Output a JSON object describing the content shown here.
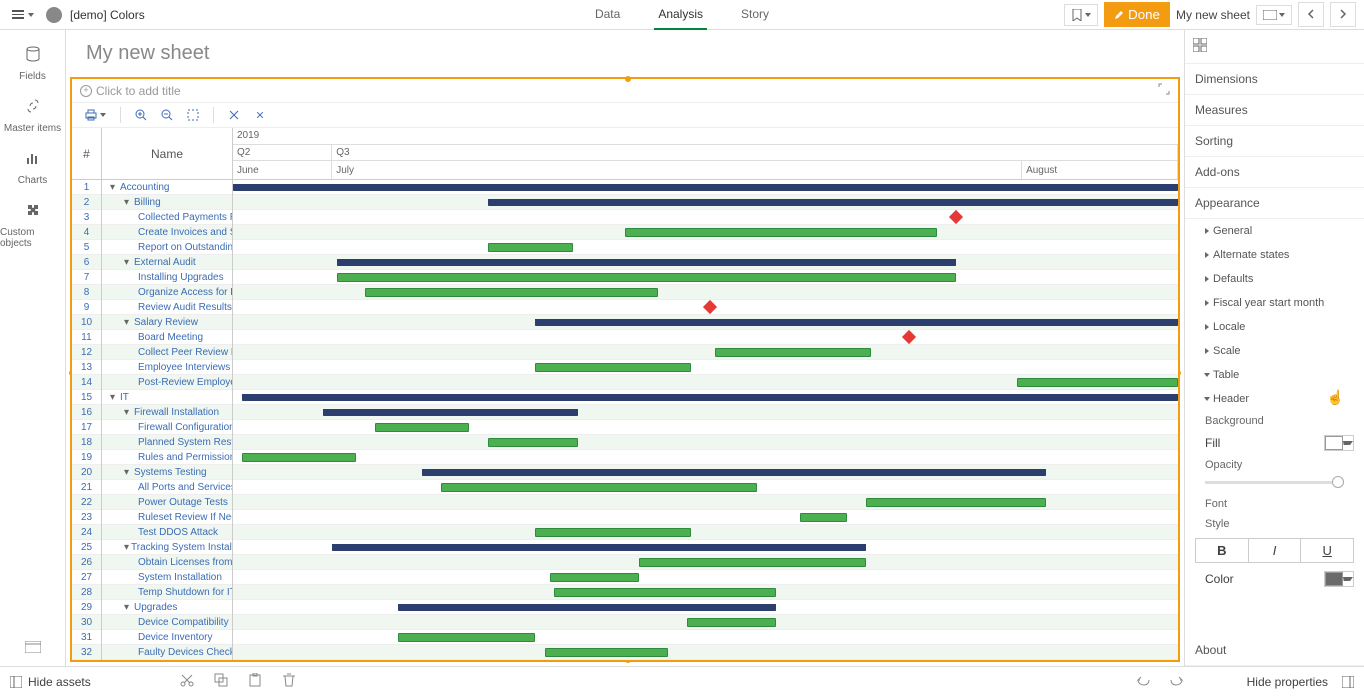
{
  "topbar": {
    "app_title": "[demo] Colors",
    "tabs": {
      "data": "Data",
      "analysis": "Analysis",
      "story": "Story"
    },
    "done": "Done",
    "sheet_name": "My new sheet"
  },
  "left_sidebar": {
    "fields": "Fields",
    "master": "Master items",
    "charts": "Charts",
    "custom": "Custom objects"
  },
  "sheet": {
    "title": "My new sheet",
    "add_title": "Click to add title"
  },
  "gantt_header": {
    "num": "#",
    "name": "Name",
    "year": "2019",
    "q2": "Q2",
    "q3": "Q3",
    "june": "June",
    "july": "July",
    "august": "August"
  },
  "gantt_rows": [
    {
      "n": "1",
      "name": "Accounting",
      "indent": 0,
      "toggle": "▾",
      "type": "group",
      "start": 0,
      "end": 100
    },
    {
      "n": "2",
      "name": "Billing",
      "indent": 1,
      "toggle": "▾",
      "type": "group",
      "start": 27,
      "end": 100
    },
    {
      "n": "3",
      "name": "Collected Payments Revie",
      "indent": 2,
      "type": "milestone",
      "pos": 76.5
    },
    {
      "n": "4",
      "name": "Create Invoices and Send t",
      "indent": 2,
      "type": "task",
      "start": 41.5,
      "end": 74.5
    },
    {
      "n": "5",
      "name": "Report on Outstanding Co",
      "indent": 2,
      "type": "task",
      "start": 27,
      "end": 36
    },
    {
      "n": "6",
      "name": "External Audit",
      "indent": 1,
      "toggle": "▾",
      "type": "group",
      "start": 11,
      "end": 76.5
    },
    {
      "n": "7",
      "name": "Installing Upgrades",
      "indent": 2,
      "type": "task",
      "start": 11,
      "end": 76.5
    },
    {
      "n": "8",
      "name": "Organize Access for Extern",
      "indent": 2,
      "type": "task",
      "start": 14,
      "end": 45
    },
    {
      "n": "9",
      "name": "Review Audit Results",
      "indent": 2,
      "type": "milestone",
      "pos": 50.5
    },
    {
      "n": "10",
      "name": "Salary Review",
      "indent": 1,
      "toggle": "▾",
      "type": "group",
      "start": 32,
      "end": 100
    },
    {
      "n": "11",
      "name": "Board Meeting",
      "indent": 2,
      "type": "milestone",
      "pos": 71.5
    },
    {
      "n": "12",
      "name": "Collect Peer Review Data",
      "indent": 2,
      "type": "task",
      "start": 51,
      "end": 67.5
    },
    {
      "n": "13",
      "name": "Employee Interviews",
      "indent": 2,
      "type": "task",
      "start": 32,
      "end": 48.5
    },
    {
      "n": "14",
      "name": "Post-Review Employee Int",
      "indent": 2,
      "type": "task",
      "start": 83,
      "end": 100
    },
    {
      "n": "15",
      "name": "IT",
      "indent": 0,
      "toggle": "▾",
      "type": "group",
      "start": 1,
      "end": 100
    },
    {
      "n": "16",
      "name": "Firewall Installation",
      "indent": 1,
      "toggle": "▾",
      "type": "group",
      "start": 9.5,
      "end": 36.5
    },
    {
      "n": "17",
      "name": "Firewall Configuration",
      "indent": 2,
      "type": "task",
      "start": 15,
      "end": 25
    },
    {
      "n": "18",
      "name": "Planned System Restart",
      "indent": 2,
      "type": "task",
      "start": 27,
      "end": 36.5
    },
    {
      "n": "19",
      "name": "Rules and Permissions Au",
      "indent": 2,
      "type": "task",
      "start": 1,
      "end": 13
    },
    {
      "n": "20",
      "name": "Systems Testing",
      "indent": 1,
      "toggle": "▾",
      "type": "group",
      "start": 20,
      "end": 86
    },
    {
      "n": "21",
      "name": "All Ports and Services Test",
      "indent": 2,
      "type": "task",
      "start": 22,
      "end": 55.5
    },
    {
      "n": "22",
      "name": "Power Outage Tests",
      "indent": 2,
      "type": "task",
      "start": 67,
      "end": 86
    },
    {
      "n": "23",
      "name": "Ruleset Review If Needed",
      "indent": 2,
      "type": "task",
      "start": 60,
      "end": 65
    },
    {
      "n": "24",
      "name": "Test DDOS Attack",
      "indent": 2,
      "type": "task",
      "start": 32,
      "end": 48.5
    },
    {
      "n": "25",
      "name": "Tracking System Installation",
      "indent": 1,
      "toggle": "▾",
      "type": "group",
      "start": 10.5,
      "end": 67
    },
    {
      "n": "26",
      "name": "Obtain Licenses from the V",
      "indent": 2,
      "type": "task",
      "start": 43,
      "end": 67
    },
    {
      "n": "27",
      "name": "System Installation",
      "indent": 2,
      "type": "task",
      "start": 33.5,
      "end": 43
    },
    {
      "n": "28",
      "name": "Temp Shutdown for IT Aud",
      "indent": 2,
      "type": "task",
      "start": 34,
      "end": 57.5
    },
    {
      "n": "29",
      "name": "Upgrades",
      "indent": 1,
      "toggle": "▾",
      "type": "group",
      "start": 17.5,
      "end": 57.5
    },
    {
      "n": "30",
      "name": "Device Compatibility Revie",
      "indent": 2,
      "type": "task",
      "start": 48,
      "end": 57.5
    },
    {
      "n": "31",
      "name": "Device Inventory",
      "indent": 2,
      "type": "task",
      "start": 17.5,
      "end": 32
    },
    {
      "n": "32",
      "name": "Faulty Devices Check",
      "indent": 2,
      "type": "task",
      "start": 33,
      "end": 46
    }
  ],
  "props": {
    "dimensions": "Dimensions",
    "measures": "Measures",
    "sorting": "Sorting",
    "addons": "Add-ons",
    "appearance": "Appearance",
    "general": "General",
    "alt_states": "Alternate states",
    "defaults": "Defaults",
    "fiscal": "Fiscal year start month",
    "locale": "Locale",
    "scale": "Scale",
    "table": "Table",
    "header": "Header",
    "background": "Background",
    "fill": "Fill",
    "opacity": "Opacity",
    "font": "Font",
    "style": "Style",
    "bold": "B",
    "italic": "I",
    "underline": "U",
    "color": "Color",
    "about": "About"
  },
  "bottom": {
    "hide_assets": "Hide assets",
    "hide_props": "Hide properties"
  },
  "colors": {
    "accent": "#f39c12",
    "group_bar": "#2c3e6e",
    "task_bar": "#4caf50",
    "milestone": "#e53935",
    "fill_swatch": "#ffffff",
    "color_swatch": "#6b6b6b"
  }
}
